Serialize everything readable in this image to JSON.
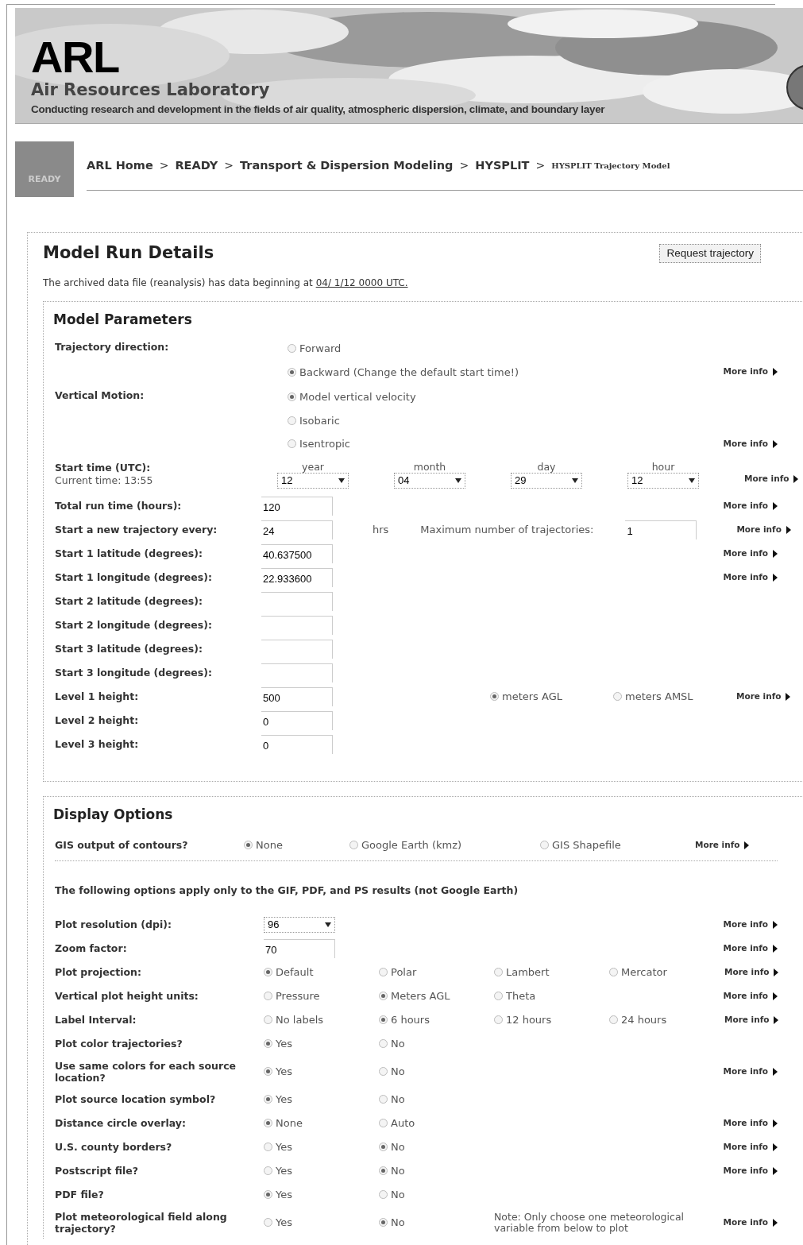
{
  "header": {
    "logo": "ARL",
    "name": "Air Resources Laboratory",
    "tagline": "Conducting research and development in the fields of air quality, atmospheric dispersion, climate, and boundary layer"
  },
  "breadcrumb": {
    "badge": "READY",
    "separator": ">",
    "items": [
      {
        "label": "ARL Home",
        "current": false
      },
      {
        "label": "READY",
        "current": false
      },
      {
        "label": "Transport & Dispersion Modeling",
        "current": false
      },
      {
        "label": "HYSPLIT",
        "current": false
      },
      {
        "label": "HYSPLIT Trajectory Model",
        "current": true
      }
    ]
  },
  "panel": {
    "title": "Model Run Details",
    "button": "Request trajectory",
    "intro": "The archived data file (reanalysis) has data beginning at",
    "intro_link": "04/ 1/12 0000 UTC."
  },
  "model_parameters": {
    "title": "Model Parameters",
    "rows": [
      {
        "label": "Trajectory direction:",
        "kind": "stack",
        "more_info": "More info",
        "controls": [
          {
            "kind": "radio",
            "label": "Forward",
            "selected": false
          },
          {
            "kind": "radio",
            "label": "Backward (Change the default start time!)",
            "selected": true
          }
        ]
      },
      {
        "label": "Vertical Motion:",
        "kind": "stack",
        "more_info": "More info",
        "controls": [
          {
            "kind": "radio",
            "label": "Model vertical velocity",
            "selected": true
          },
          {
            "kind": "radio",
            "label": "Isobaric",
            "selected": false
          },
          {
            "kind": "radio",
            "label": "Isentropic",
            "selected": false
          }
        ]
      },
      {
        "label": "Start time (UTC):",
        "sublabel": "Current time: 13:55",
        "kind": "selects",
        "more_info": "More info",
        "controls": [
          {
            "kind": "select",
            "caption": "year",
            "value": "12"
          },
          {
            "kind": "select",
            "caption": "month",
            "value": "04"
          },
          {
            "kind": "select",
            "caption": "day",
            "value": "29"
          },
          {
            "kind": "select",
            "caption": "hour",
            "value": "12"
          }
        ]
      },
      {
        "label": "Total run time (hours):",
        "kind": "line",
        "more_info": "More info",
        "controls": [
          {
            "kind": "input",
            "value": "120"
          }
        ]
      },
      {
        "label": "Start a new trajectory every:",
        "kind": "line",
        "more_info": "More info",
        "controls": [
          {
            "kind": "input",
            "value": "24"
          },
          {
            "kind": "text",
            "text": "hrs"
          },
          {
            "kind": "text",
            "text": "Maximum number of trajectories:"
          },
          {
            "kind": "input",
            "value": "1"
          }
        ]
      },
      {
        "label": "Start 1 latitude (degrees):",
        "kind": "line",
        "more_info": "More info",
        "controls": [
          {
            "kind": "input",
            "value": "40.637500"
          }
        ]
      },
      {
        "label": "Start 1 longitude (degrees):",
        "kind": "line",
        "more_info": "More info",
        "controls": [
          {
            "kind": "input",
            "value": "22.933600"
          }
        ]
      },
      {
        "label": "Start 2 latitude (degrees):",
        "kind": "line",
        "controls": [
          {
            "kind": "input"
          }
        ]
      },
      {
        "label": "Start 2 longitude (degrees):",
        "kind": "line",
        "controls": [
          {
            "kind": "input"
          }
        ]
      },
      {
        "label": "Start 3 latitude (degrees):",
        "kind": "line",
        "controls": [
          {
            "kind": "input"
          }
        ]
      },
      {
        "label": "Start 3 longitude (degrees):",
        "kind": "line",
        "controls": [
          {
            "kind": "input"
          }
        ]
      },
      {
        "label": "Level 1 height:",
        "kind": "line",
        "more_info": "More info",
        "controls": [
          {
            "kind": "input",
            "value": "500"
          },
          {
            "kind": "gap"
          },
          {
            "kind": "radio",
            "label": "meters AGL",
            "selected": true
          },
          {
            "kind": "radio",
            "label": "meters AMSL",
            "selected": false
          }
        ]
      },
      {
        "label": "Level 2 height:",
        "kind": "line",
        "controls": [
          {
            "kind": "input",
            "value": "0"
          }
        ]
      },
      {
        "label": "Level 3 height:",
        "kind": "line",
        "controls": [
          {
            "kind": "input",
            "value": "0"
          }
        ]
      }
    ]
  },
  "display_options": {
    "title": "Display Options",
    "gis": {
      "label": "GIS output of contours?",
      "more_info": "More info",
      "controls": [
        {
          "kind": "radio",
          "label": "None",
          "selected": true
        },
        {
          "kind": "radio",
          "label": "Google Earth (kmz)",
          "selected": false
        },
        {
          "kind": "radio",
          "label": "GIS Shapefile",
          "selected": false
        }
      ]
    },
    "note": "The following options apply only to the GIF, PDF, and PS results (not Google Earth)",
    "rows": [
      {
        "label": "Plot resolution (dpi):",
        "more_info": "More info",
        "controls": [
          {
            "kind": "select",
            "value": "96"
          }
        ]
      },
      {
        "label": "Zoom factor:",
        "more_info": "More info",
        "controls": [
          {
            "kind": "input",
            "value": "70"
          }
        ]
      },
      {
        "label": "Plot projection:",
        "more_info": "More info",
        "controls": [
          {
            "kind": "radio",
            "label": "Default",
            "selected": true
          },
          {
            "kind": "radio",
            "label": "Polar",
            "selected": false
          },
          {
            "kind": "radio",
            "label": "Lambert",
            "selected": false
          },
          {
            "kind": "radio",
            "label": "Mercator",
            "selected": false
          }
        ]
      },
      {
        "label": "Vertical plot height units:",
        "more_info": "More info",
        "controls": [
          {
            "kind": "radio",
            "label": "Pressure",
            "selected": false
          },
          {
            "kind": "radio",
            "label": "Meters AGL",
            "selected": true
          },
          {
            "kind": "radio",
            "label": "Theta",
            "selected": false
          }
        ]
      },
      {
        "label": "Label Interval:",
        "more_info": "More info",
        "controls": [
          {
            "kind": "radio",
            "label": "No labels",
            "selected": false
          },
          {
            "kind": "radio",
            "label": "6 hours",
            "selected": true
          },
          {
            "kind": "radio",
            "label": "12 hours",
            "selected": false
          },
          {
            "kind": "radio",
            "label": "24 hours",
            "selected": false
          }
        ]
      },
      {
        "label": "Plot color trajectories?",
        "controls": [
          {
            "kind": "radio",
            "label": "Yes",
            "selected": true
          },
          {
            "kind": "radio",
            "label": "No",
            "selected": false
          }
        ]
      },
      {
        "label": "Use same colors for each source location?",
        "more_info": "More info",
        "controls": [
          {
            "kind": "radio",
            "label": "Yes",
            "selected": true
          },
          {
            "kind": "radio",
            "label": "No",
            "selected": false
          }
        ]
      },
      {
        "label": "Plot source location symbol?",
        "controls": [
          {
            "kind": "radio",
            "label": "Yes",
            "selected": true
          },
          {
            "kind": "radio",
            "label": "No",
            "selected": false
          }
        ]
      },
      {
        "label": "Distance circle overlay:",
        "more_info": "More info",
        "controls": [
          {
            "kind": "radio",
            "label": "None",
            "selected": true
          },
          {
            "kind": "radio",
            "label": "Auto",
            "selected": false
          }
        ]
      },
      {
        "label": "U.S. county borders?",
        "more_info": "More info",
        "controls": [
          {
            "kind": "radio",
            "label": "Yes",
            "selected": false
          },
          {
            "kind": "radio",
            "label": "No",
            "selected": true
          }
        ]
      },
      {
        "label": "Postscript file?",
        "more_info": "More info",
        "controls": [
          {
            "kind": "radio",
            "label": "Yes",
            "selected": false
          },
          {
            "kind": "radio",
            "label": "No",
            "selected": true
          }
        ]
      },
      {
        "label": "PDF file?",
        "controls": [
          {
            "kind": "radio",
            "label": "Yes",
            "selected": true
          },
          {
            "kind": "radio",
            "label": "No",
            "selected": false
          }
        ]
      },
      {
        "label": "Plot meteorological field along trajectory?",
        "more_info": "More info",
        "controls": [
          {
            "kind": "radio",
            "label": "Yes",
            "selected": false
          },
          {
            "kind": "radio",
            "label": "No",
            "selected": true
          },
          {
            "kind": "note",
            "text": "Note: Only choose one meteorological variable from below to plot"
          }
        ]
      }
    ]
  }
}
